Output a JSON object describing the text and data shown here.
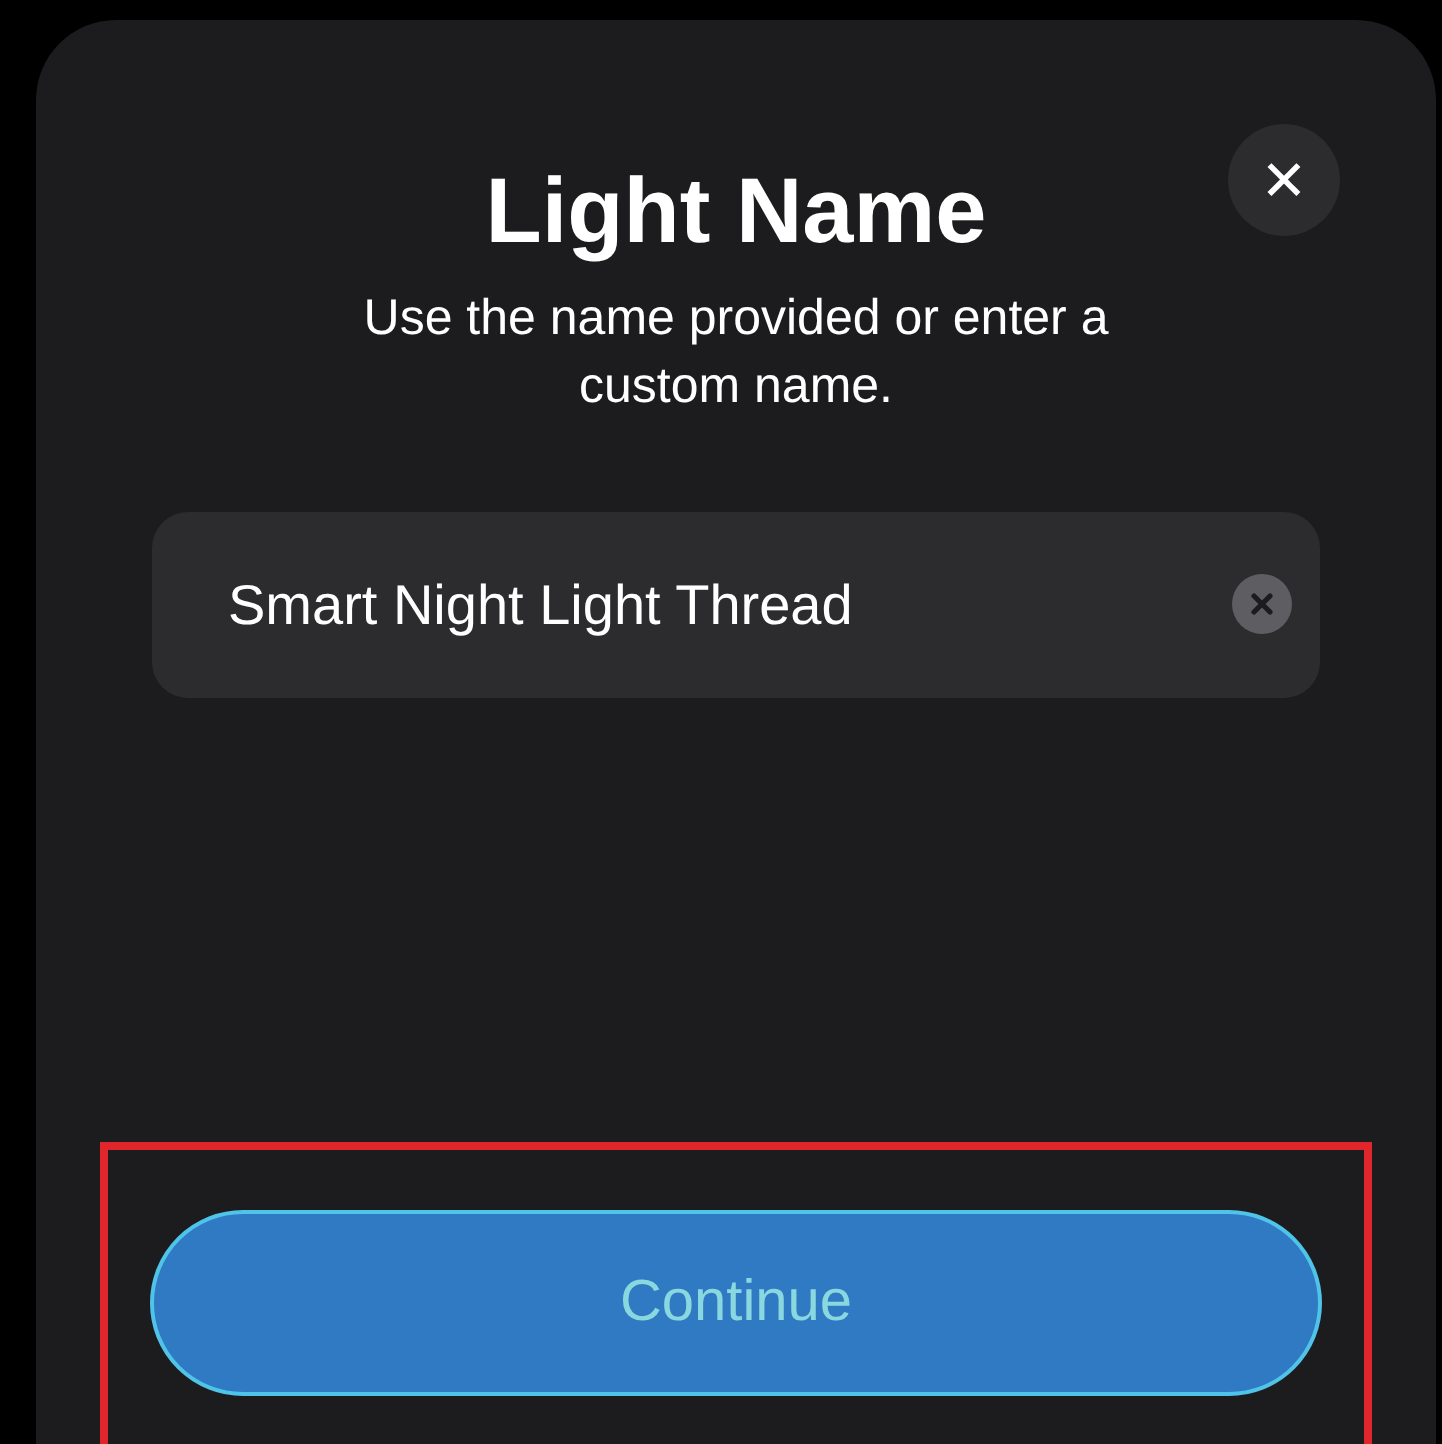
{
  "sheet": {
    "title": "Light Name",
    "subtitle": "Use the name provided or enter a custom name.",
    "close_button": "✕"
  },
  "name_field": {
    "value": "Smart Night Light Thread",
    "clear_button": true
  },
  "continue_button": {
    "label": "Continue",
    "highlighted": true
  }
}
